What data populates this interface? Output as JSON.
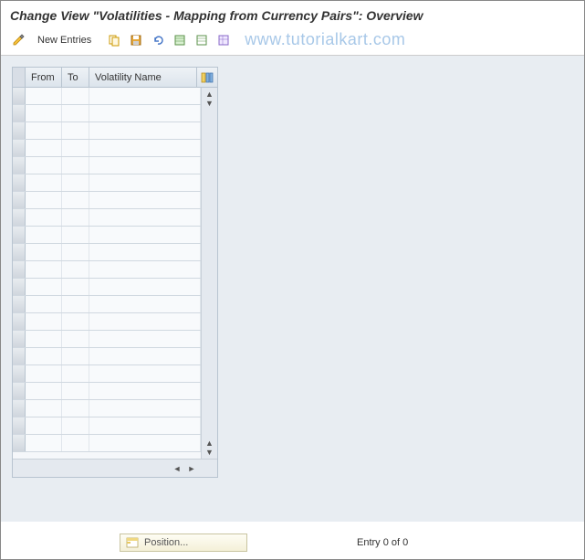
{
  "title": "Change View \"Volatilities - Mapping from Currency Pairs\": Overview",
  "toolbar": {
    "new_entries": "New Entries"
  },
  "watermark": "www.tutorialkart.com",
  "table": {
    "columns": {
      "from": "From",
      "to": "To",
      "volatility_name": "Volatility Name"
    },
    "rows": []
  },
  "footer": {
    "position_label": "Position...",
    "entry_status": "Entry 0 of 0"
  }
}
